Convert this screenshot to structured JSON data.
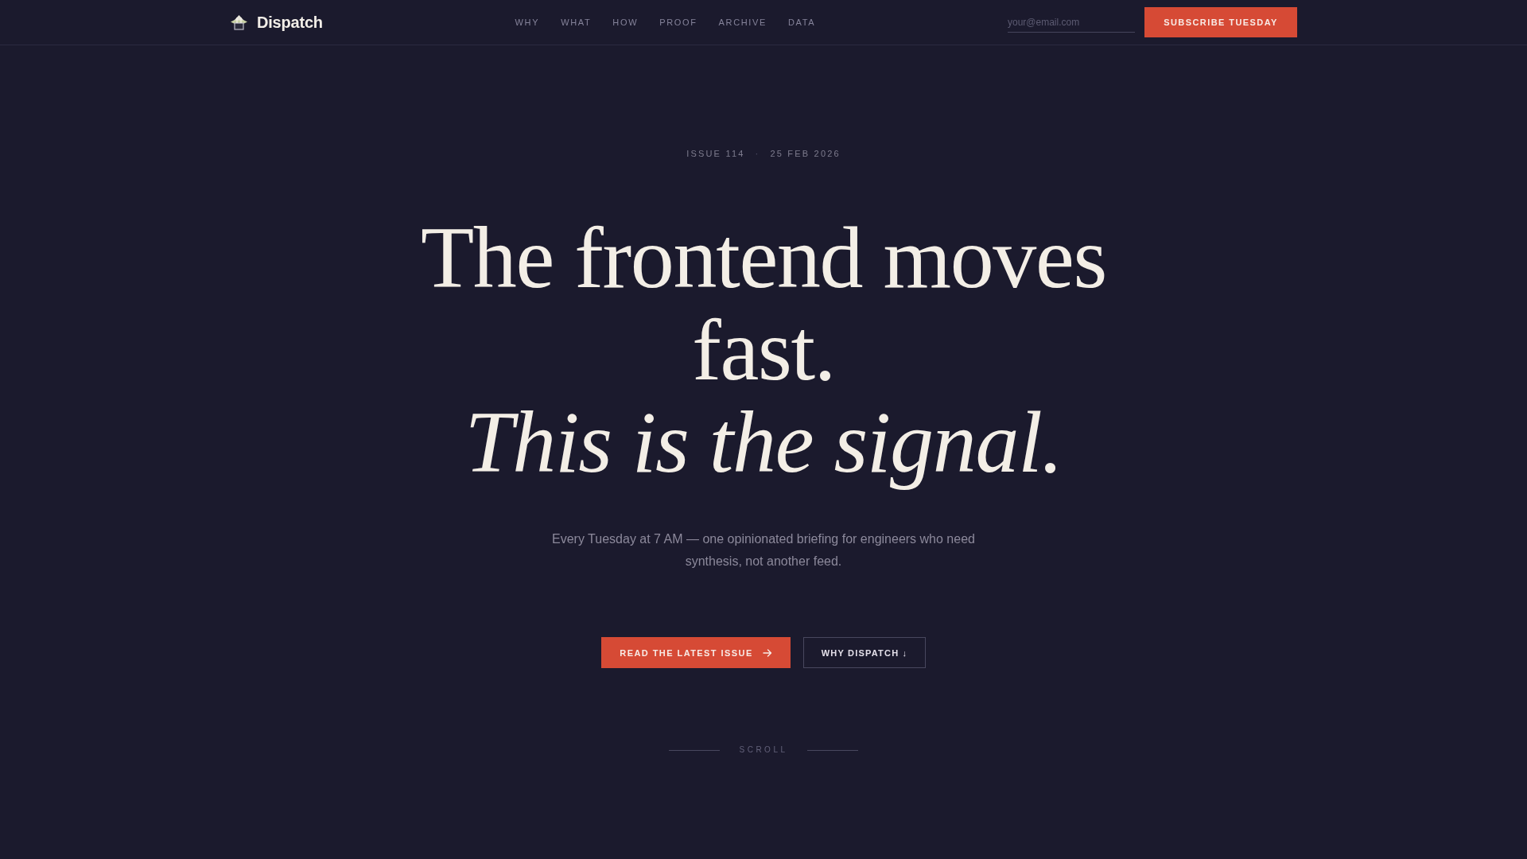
{
  "header": {
    "brand": "Dispatch",
    "nav": [
      "WHY",
      "WHAT",
      "HOW",
      "PROOF",
      "ARCHIVE",
      "DATA"
    ],
    "email": {
      "placeholder": "your@email.com"
    },
    "subscribe_button": "SUBSCRIBE TUESDAY"
  },
  "hero": {
    "issue": "ISSUE 114",
    "separator": "·",
    "date": "25 FEB 2026",
    "headline": "The frontend moves fast.",
    "headline_accent": "This is the signal.",
    "subtitle": "Every Tuesday at 7 AM — one opinionated briefing for engineers who need synthesis, not another feed.",
    "primary_button": "READ THE LATEST ISSUE",
    "secondary_button": "WHY DISPATCH ↓",
    "scroll": "SCROLL"
  }
}
